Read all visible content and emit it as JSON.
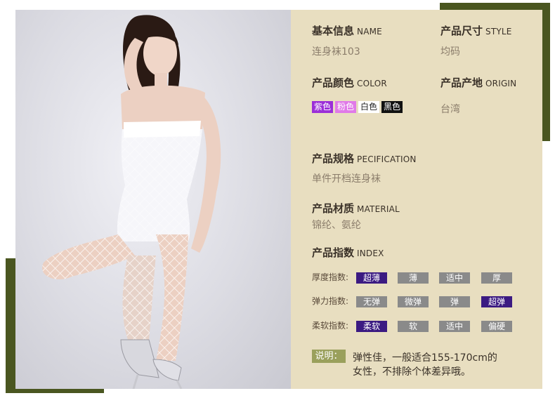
{
  "colors": {
    "accent_olive": "#4a5620",
    "panel_bg": "#e8dec0",
    "active_level": "#3b1a82",
    "inactive_level": "#8a8a8a",
    "note_tag_bg": "#9aa05c"
  },
  "basic_info": {
    "title": "基本信息",
    "title_en": "NAME",
    "value": "连身袜103"
  },
  "size": {
    "title": "产品尺寸",
    "title_en": "STYLE",
    "value": "均码"
  },
  "color": {
    "title": "产品颜色",
    "title_en": "COLOR",
    "options": [
      {
        "label": "紫色",
        "bg": "#9b2fd8",
        "fg": "#ffffff"
      },
      {
        "label": "粉色",
        "bg": "#e07ae8",
        "fg": "#ffffff"
      },
      {
        "label": "白色",
        "bg": "#ffffff",
        "fg": "#222222"
      },
      {
        "label": "黑色",
        "bg": "#111111",
        "fg": "#ffffff"
      }
    ]
  },
  "origin": {
    "title": "产品产地",
    "title_en": "ORIGIN",
    "value": "台湾"
  },
  "spec": {
    "title": "产品规格",
    "title_en": "PECIFICATION",
    "value": "单件开档连身袜"
  },
  "material": {
    "title": "产品材质",
    "title_en": "MATERIAL",
    "value": "锦纶、氨纶"
  },
  "index": {
    "title": "产品指数",
    "title_en": "INDEX",
    "rows": [
      {
        "label": "厚度指数:",
        "levels": [
          "超薄",
          "薄",
          "适中",
          "厚"
        ],
        "selected": 0
      },
      {
        "label": "弹力指数:",
        "levels": [
          "无弹",
          "微弹",
          "弹",
          "超弹"
        ],
        "selected": 3
      },
      {
        "label": "柔软指数:",
        "levels": [
          "柔软",
          "软",
          "适中",
          "偏硬"
        ],
        "selected": 0
      }
    ]
  },
  "note": {
    "tag": "说明：",
    "line1": "弹性佳，一般适合155-170cm的",
    "line2": "女性，不排除个体差异哦。"
  }
}
